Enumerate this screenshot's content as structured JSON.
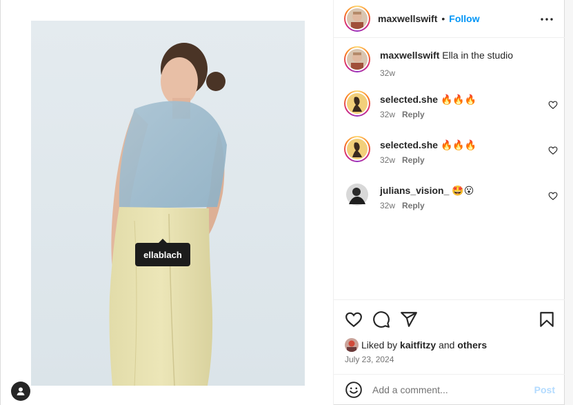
{
  "post": {
    "author": "maxwellswift",
    "separator": "•",
    "follow_label": "Follow",
    "caption": "Ella in the studio",
    "caption_age": "32w",
    "photo_tag": "ellablach"
  },
  "comments": [
    {
      "user": "selected.she",
      "text": "🔥🔥🔥",
      "age": "32w",
      "reply_label": "Reply"
    },
    {
      "user": "selected.she",
      "text": "🔥🔥🔥",
      "age": "32w",
      "reply_label": "Reply"
    },
    {
      "user": "julians_vision_",
      "text": "🤩😮",
      "age": "32w",
      "reply_label": "Reply"
    }
  ],
  "likes": {
    "prefix": "Liked by",
    "user": "kaitfitzy",
    "and": "and",
    "others": "others"
  },
  "date": "July 23, 2024",
  "composer": {
    "placeholder": "Add a comment...",
    "post_label": "Post"
  },
  "icons": {
    "more": "more-horizontal-icon",
    "like": "heart-icon",
    "comment": "comment-bubble-icon",
    "share": "send-icon",
    "save": "bookmark-icon",
    "emoji": "emoji-icon",
    "user_tags": "user-icon"
  },
  "colors": {
    "accent": "#0095f6",
    "post_disabled": "#b3dbff",
    "muted": "#737373"
  }
}
